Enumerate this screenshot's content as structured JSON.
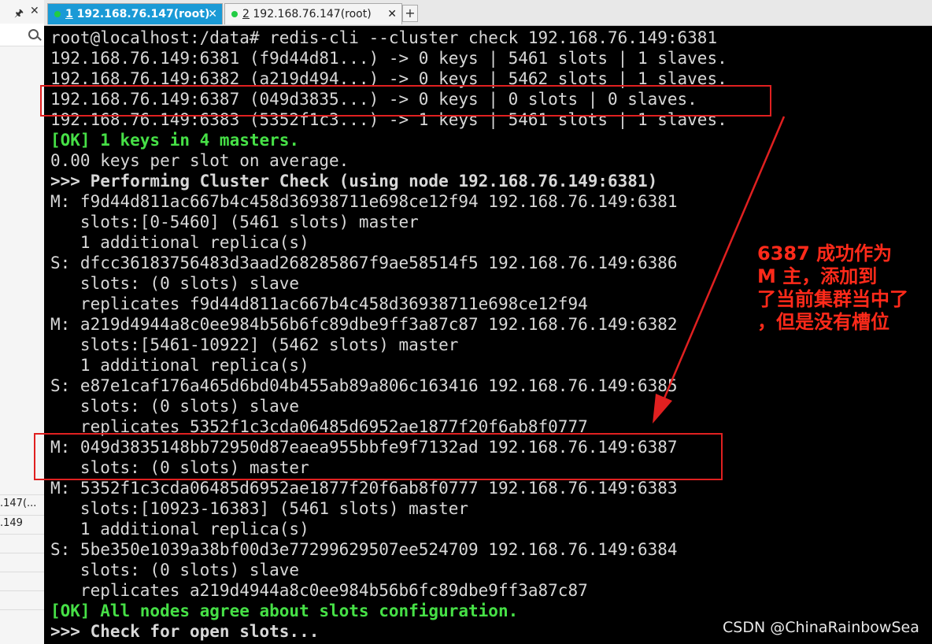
{
  "sidebar": {
    "pin_icon": "pin-icon",
    "close_glyph": "✕",
    "items": [
      ".147(...",
      ".149"
    ]
  },
  "tabs": [
    {
      "index": "1",
      "label": "192.168.76.147(root)",
      "active": true
    },
    {
      "index": "2",
      "label": "192.168.76.147(root)",
      "active": false
    }
  ],
  "new_tab_label": "+",
  "terminal": {
    "lines": [
      {
        "text": "root@localhost:/data# redis-cli --cluster check 192.168.76.149:6381",
        "style": "normal"
      },
      {
        "text": "192.168.76.149:6381 (f9d44d81...) -> 0 keys | 5461 slots | 1 slaves.",
        "style": "normal"
      },
      {
        "text": "192.168.76.149:6382 (a219d494...) -> 0 keys | 5462 slots | 1 slaves.",
        "style": "normal"
      },
      {
        "text": "192.168.76.149:6387 (049d3835...) -> 0 keys | 0 slots | 0 slaves.",
        "style": "normal"
      },
      {
        "text": "192.168.76.149:6383 (5352f1c3...) -> 1 keys | 5461 slots | 1 slaves.",
        "style": "normal"
      },
      {
        "text": "[OK] 1 keys in 4 masters.",
        "style": "green"
      },
      {
        "text": "0.00 keys per slot on average.",
        "style": "normal"
      },
      {
        "text": ">>> Performing Cluster Check (using node 192.168.76.149:6381)",
        "style": "bold"
      },
      {
        "text": "M: f9d44d811ac667b4c458d36938711e698ce12f94 192.168.76.149:6381",
        "style": "normal"
      },
      {
        "text": "   slots:[0-5460] (5461 slots) master",
        "style": "normal"
      },
      {
        "text": "   1 additional replica(s)",
        "style": "normal"
      },
      {
        "text": "S: dfcc36183756483d3aad268285867f9ae58514f5 192.168.76.149:6386",
        "style": "normal"
      },
      {
        "text": "   slots: (0 slots) slave",
        "style": "normal"
      },
      {
        "text": "   replicates f9d44d811ac667b4c458d36938711e698ce12f94",
        "style": "normal"
      },
      {
        "text": "M: a219d4944a8c0ee984b56b6fc89dbe9ff3a87c87 192.168.76.149:6382",
        "style": "normal"
      },
      {
        "text": "   slots:[5461-10922] (5462 slots) master",
        "style": "normal"
      },
      {
        "text": "   1 additional replica(s)",
        "style": "normal"
      },
      {
        "text": "S: e87e1caf176a465d6bd04b455ab89a806c163416 192.168.76.149:6385",
        "style": "normal"
      },
      {
        "text": "   slots: (0 slots) slave",
        "style": "normal"
      },
      {
        "text": "   replicates 5352f1c3cda06485d6952ae1877f20f6ab8f0777",
        "style": "normal"
      },
      {
        "text": "M: 049d3835148bb72950d87eaea955bbfe9f7132ad 192.168.76.149:6387",
        "style": "normal"
      },
      {
        "text": "   slots: (0 slots) master",
        "style": "normal"
      },
      {
        "text": "M: 5352f1c3cda06485d6952ae1877f20f6ab8f0777 192.168.76.149:6383",
        "style": "normal"
      },
      {
        "text": "   slots:[10923-16383] (5461 slots) master",
        "style": "normal"
      },
      {
        "text": "   1 additional replica(s)",
        "style": "normal"
      },
      {
        "text": "S: 5be350e1039a38bf00d3e77299629507ee524709 192.168.76.149:6384",
        "style": "normal"
      },
      {
        "text": "   slots: (0 slots) slave",
        "style": "normal"
      },
      {
        "text": "   replicates a219d4944a8c0ee984b56b6fc89dbe9ff3a87c87",
        "style": "normal"
      },
      {
        "text": "[OK] All nodes agree about slots configuration.",
        "style": "green"
      },
      {
        "text": ">>> Check for open slots...",
        "style": "bold"
      }
    ]
  },
  "annotation": {
    "lines": [
      "6387 成功作为",
      "M 主，添加到",
      "了当前集群当中了",
      "，但是没有槽位"
    ],
    "color": "#ff2a1a"
  },
  "watermark": "CSDN @ChinaRainbowSea",
  "colors": {
    "terminal_bg": "#000000",
    "terminal_fg": "#d8d8d8",
    "ok_green": "#46e046",
    "active_tab": "#1a9ad6",
    "highlight_red": "#e02020"
  }
}
